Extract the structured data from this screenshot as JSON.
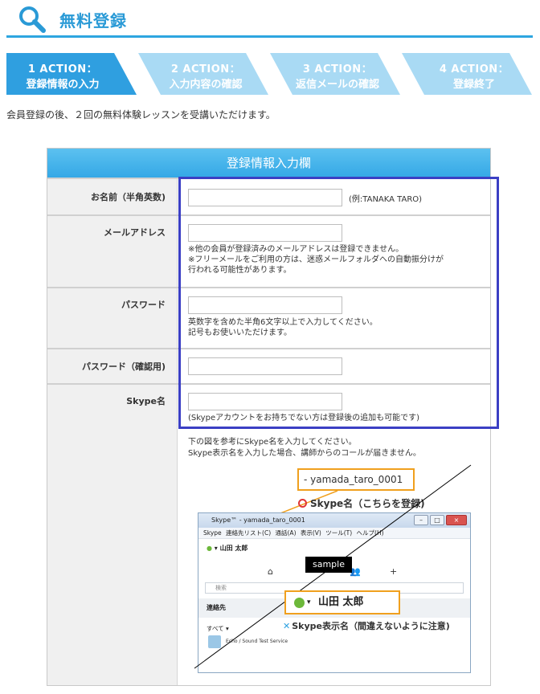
{
  "header": {
    "title": "無料登録"
  },
  "steps": [
    {
      "line1": "1 ACTION：",
      "line2": "登録情報の入力",
      "color": "#2f9fe0"
    },
    {
      "line1": "2 ACTION：",
      "line2": "入力内容の確認",
      "color": "#a9daf4"
    },
    {
      "line1": "3 ACTION：",
      "line2": "返信メールの確認",
      "color": "#a9daf4"
    },
    {
      "line1": "4 ACTION：",
      "line2": "登録終了",
      "color": "#a9daf4"
    }
  ],
  "lead": "会員登録の後、２回の無料体験レッスンを受講いただけます。",
  "form": {
    "heading": "登録情報入力欄",
    "name": {
      "label": "お名前（半角英数)",
      "value": "",
      "hint": "(例:TANAKA TARO)"
    },
    "email": {
      "label": "メールアドレス",
      "value": "",
      "notes": [
        "※他の会員が登録済みのメールアドレスは登録できません。",
        "※フリーメールをご利用の方は、迷惑メールフォルダへの自動振分けが",
        "行われる可能性があります。"
      ]
    },
    "password": {
      "label": "パスワード",
      "value": "",
      "notes": [
        "英数字を含めた半角6文字以上で入力してください。",
        "記号もお使いいただけます。"
      ]
    },
    "password_confirm": {
      "label": "パスワード（確認用)",
      "value": ""
    },
    "skype": {
      "label": "Skype名",
      "value": "",
      "notes": [
        "(Skypeアカウントをお持ちでない方は登録後の追加も可能です)"
      ]
    },
    "skype_intro": [
      "下の図を参考にSkype名を入力してください。",
      "Skype表示名を入力した場合、講師からのコールが届きません。"
    ]
  },
  "example": {
    "skype_id": "- yamada_taro_0001",
    "ok_label": "Skype名（こちらを登録)",
    "window_title": "Skype™ - yamada_taro_0001",
    "menu": "Skype 連絡先リスト(C) 通話(A) 表示(V) ツール(T) ヘルプ(H)",
    "user": "山田 太郎",
    "search_placeholder": "検索",
    "contacts_label": "連絡先",
    "all_label": "すべて ▾",
    "echo": "Echo / Sound Test Service",
    "display_name": "山田 太郎",
    "ng_label": "Skype表示名（間違えないように注意)",
    "sample_badge": "sample",
    "colors": {
      "accent": "#2ea6e0",
      "highlight": "#3b3fc4",
      "callout": "#f0a01e"
    }
  }
}
